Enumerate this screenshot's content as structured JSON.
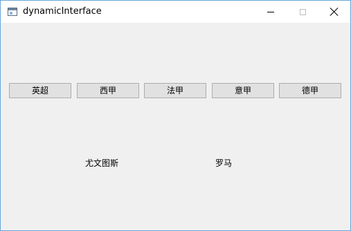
{
  "window": {
    "title": "dynamicInterface",
    "controls": {
      "minimize": "minimize",
      "maximize": "maximize",
      "close": "close"
    }
  },
  "buttons": [
    {
      "label": "英超"
    },
    {
      "label": "西甲"
    },
    {
      "label": "法甲"
    },
    {
      "label": "意甲"
    },
    {
      "label": "德甲"
    }
  ],
  "labels": [
    {
      "text": "尤文图斯"
    },
    {
      "text": "罗马"
    }
  ],
  "colors": {
    "window_border": "#67a6d8",
    "client_bg": "#f0f0f0",
    "button_bg": "#e1e1e1",
    "button_border": "#adadad"
  }
}
